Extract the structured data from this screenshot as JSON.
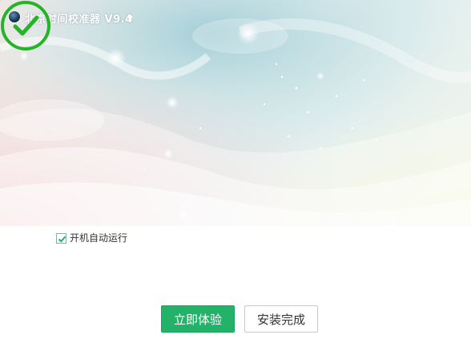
{
  "app": {
    "title": "北京时间校准器 V9.4"
  },
  "status": {
    "icon": "check-circle-icon",
    "color": "#22b526"
  },
  "options": {
    "autostart_label": "开机自动运行",
    "autostart_checked": true
  },
  "actions": {
    "try_now_label": "立即体验",
    "finish_label": "安装完成"
  },
  "colors": {
    "primary": "#22b26a",
    "check": "#22b526"
  }
}
